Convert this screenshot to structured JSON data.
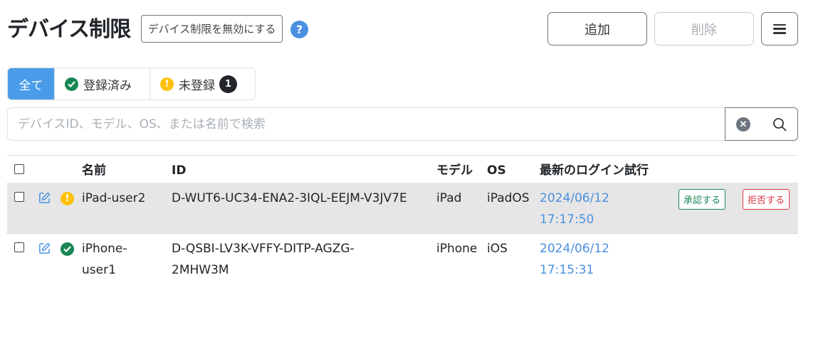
{
  "header": {
    "title": "デバイス制限",
    "disable_label": "デバイス制限を無効にする",
    "help_glyph": "?",
    "add_label": "追加",
    "delete_label": "削除"
  },
  "filters": {
    "all_label": "全て",
    "registered_label": "登録済み",
    "unregistered_label": "未登録",
    "unregistered_count": "1"
  },
  "search": {
    "placeholder": "デバイスID、モデル、OS、または名前で検索",
    "value": ""
  },
  "table": {
    "columns": {
      "name": "名前",
      "id": "ID",
      "model": "モデル",
      "os": "OS",
      "last_login": "最新のログイン試行"
    },
    "rows": [
      {
        "status": "warning",
        "name": "iPad-user2",
        "id": "D-WUT6-UC34-ENA2-3IQL-EEJM-V3JV7E",
        "model": "iPad",
        "os": "iPadOS",
        "date": "2024/06/12",
        "time": "17:17:50",
        "approve_label": "承認する",
        "reject_label": "拒否する"
      },
      {
        "status": "registered",
        "name_line1": "iPhone-",
        "name_line2": "user1",
        "id_line1": "D-QSBI-LV3K-VFFY-DITP-AGZG-",
        "id_line2": "2MHW3M",
        "model": "iPhone",
        "os": "iOS",
        "date": "2024/06/12",
        "time": "17:15:31"
      }
    ]
  },
  "colors": {
    "primary": "#4a9ce8",
    "success": "#198754",
    "warning": "#ffc107",
    "danger": "#dc3545",
    "link": "#4a90e2",
    "selected_row": "#e6e6e6"
  },
  "icons": [
    "help-icon",
    "check-circle-icon",
    "warning-circle-icon",
    "clear-icon",
    "search-icon",
    "edit-icon",
    "menu-icon"
  ]
}
